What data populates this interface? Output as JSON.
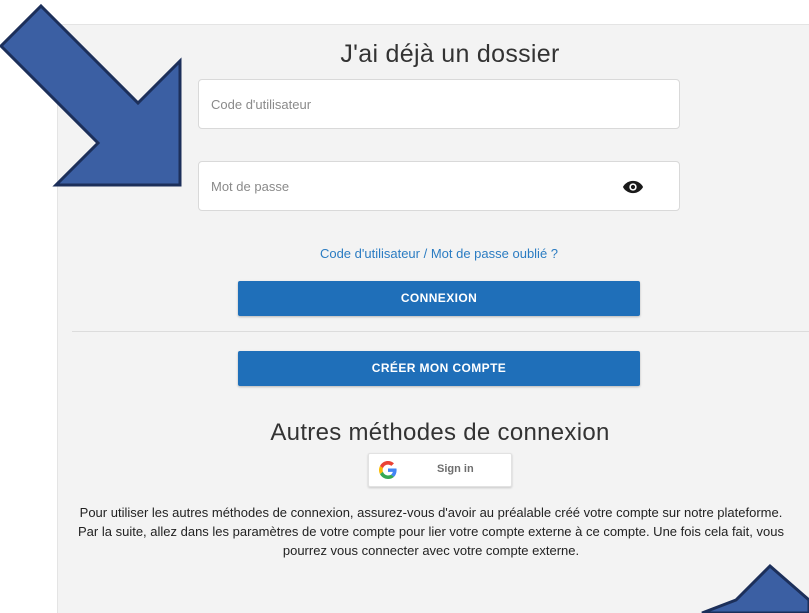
{
  "login": {
    "title": "J'ai déjà un dossier",
    "username_placeholder": "Code d'utilisateur",
    "username_value": "",
    "password_placeholder": "Mot de passe",
    "password_value": "",
    "show_password_icon": "eye-icon",
    "forgot_link": "Code d'utilisateur / Mot de passe oublié ?",
    "login_button": "CONNEXION",
    "create_account_button": "CRÉER MON COMPTE"
  },
  "other_methods": {
    "title": "Autres méthodes de connexion",
    "google_icon": "google-g-icon",
    "google_button": "Sign in",
    "info_text": "Pour utiliser les autres méthodes de connexion, assurez-vous d'avoir au préalable créé votre compte sur notre plateforme. Par la suite, allez dans les paramètres de votre compte pour lier votre compte externe à ce compte. Une fois cela fait, vous pourrez vous connecter avec votre compte externe."
  },
  "colors": {
    "primary_button": "#1f6fb9",
    "link": "#2b7cc2",
    "panel_background": "#f3f3f3",
    "annotation_arrow": "#3b5fa3"
  }
}
